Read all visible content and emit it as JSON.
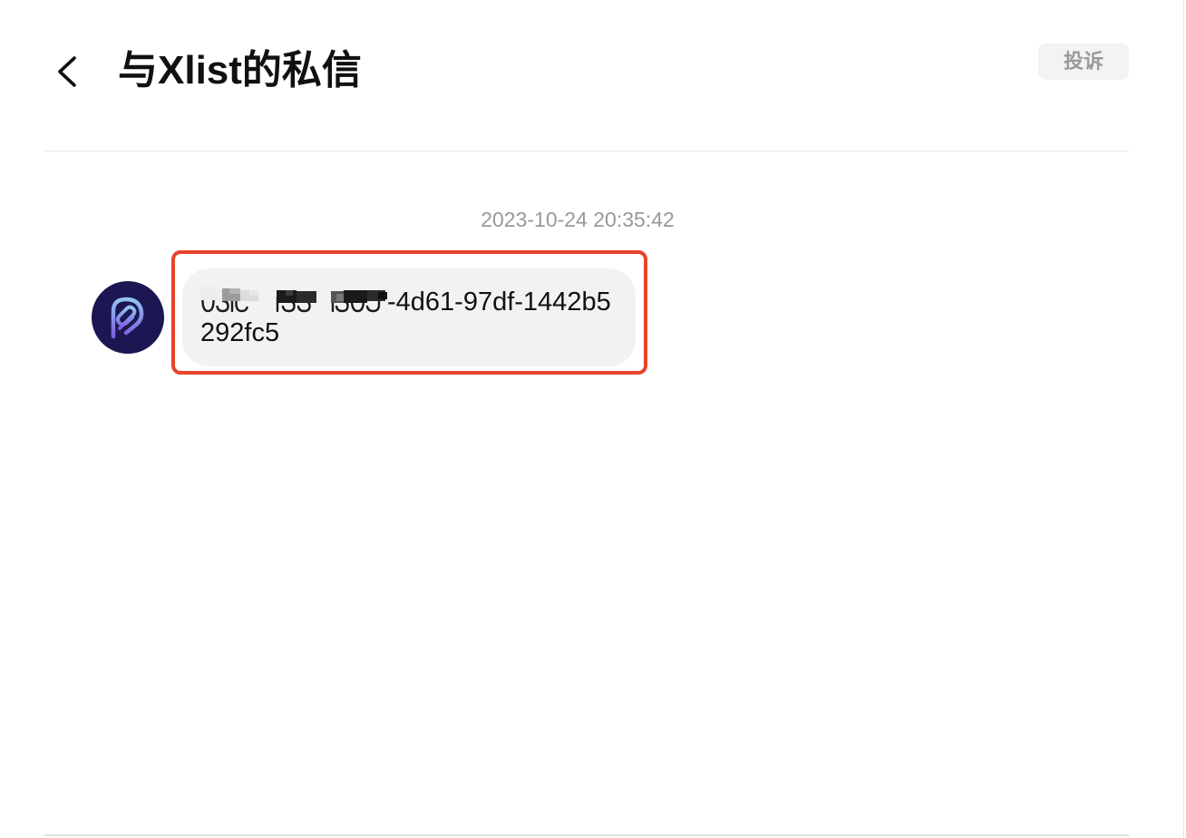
{
  "header": {
    "back_icon": "chevron-left-icon",
    "title": "与Xlist的私信",
    "report_label": "投诉"
  },
  "conversation": {
    "timestamp": "2023-10-24 20:35:42",
    "messages": [
      {
        "avatar_icon": "paperclip-logo-icon",
        "visible_text_line1": "-4d61-97df-1442b5",
        "text_line2": "292fc5"
      }
    ]
  },
  "theme": {
    "highlight": "#e8432b",
    "avatar-bg": "#1c1652",
    "bubble-bg": "#f2f2f2",
    "muted": "#999999"
  }
}
